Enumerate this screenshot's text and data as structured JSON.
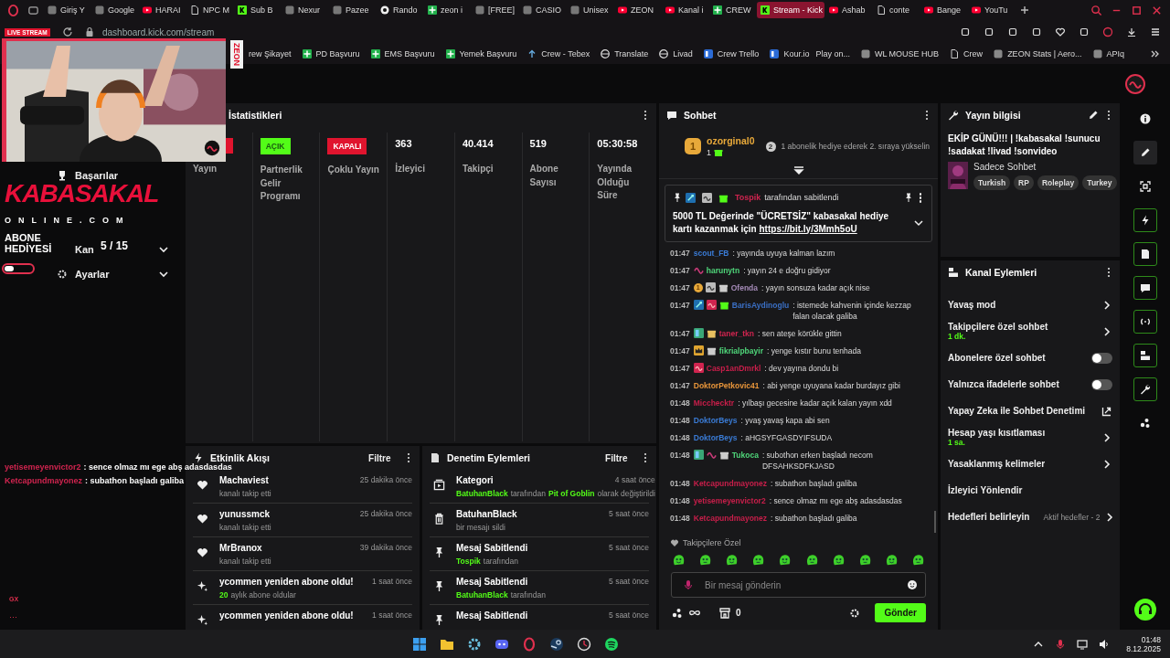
{
  "browser": {
    "tabs": [
      {
        "title": "Giriş Y",
        "kind": "generic",
        "selected": false
      },
      {
        "title": "Google",
        "kind": "generic",
        "selected": false
      },
      {
        "title": "HARAI",
        "kind": "youtube",
        "selected": false
      },
      {
        "title": "NPC M",
        "kind": "doc",
        "selected": false
      },
      {
        "title": "Sub B",
        "kind": "kick",
        "selected": false
      },
      {
        "title": "Nexur",
        "kind": "generic",
        "selected": false
      },
      {
        "title": "Pazee",
        "kind": "generic",
        "selected": false
      },
      {
        "title": "Rando",
        "kind": "github",
        "selected": false
      },
      {
        "title": "zeon i",
        "kind": "sheet",
        "selected": false
      },
      {
        "title": "[FREE]",
        "kind": "generic",
        "selected": false
      },
      {
        "title": "CASIO",
        "kind": "generic",
        "selected": false
      },
      {
        "title": "Unisex",
        "kind": "generic",
        "selected": false
      },
      {
        "title": "ZEON",
        "kind": "youtube",
        "selected": false
      },
      {
        "title": "Kanal i",
        "kind": "youtube",
        "selected": false
      },
      {
        "title": "CREW",
        "kind": "sheet",
        "selected": false
      },
      {
        "title": "Stream - Kick",
        "kind": "kick",
        "selected": true
      },
      {
        "title": "Ashab",
        "kind": "youtube",
        "selected": false
      },
      {
        "title": "conte",
        "kind": "doc",
        "selected": false
      },
      {
        "title": "Bange",
        "kind": "youtube",
        "selected": false
      },
      {
        "title": "YouTu",
        "kind": "youtube",
        "selected": false
      }
    ],
    "url": "dashboard.kick.com/stream",
    "bookmarks": [
      {
        "label": "rew Şikayet"
      },
      {
        "label": "PD Başvuru",
        "kind": "sheet"
      },
      {
        "label": "EMS Başvuru",
        "kind": "sheet"
      },
      {
        "label": "Yemek Başvuru",
        "kind": "sheet"
      },
      {
        "label": "Crew - Tebex",
        "kind": "arrow"
      },
      {
        "label": "Translate",
        "kind": "globe"
      },
      {
        "label": "Livad",
        "kind": "globe"
      },
      {
        "label": "Crew Trello",
        "kind": "board"
      },
      {
        "label": "Kour.io",
        "after": "Play on...",
        "kind": "board"
      },
      {
        "label": "WL MOUSE HUB",
        "kind": "generic"
      },
      {
        "label": "Crew",
        "kind": "doc"
      },
      {
        "label": "ZEON Stats | Aero...",
        "kind": "generic"
      },
      {
        "label": "APIq",
        "kind": "generic"
      }
    ]
  },
  "overlay": {
    "live_badge": "LIVE STREAM",
    "side_text": "ZEON",
    "logo": "KABASAKAL",
    "logo_sub": "ONLINE.COM",
    "goal_label": "ABONE HEDİYESİ",
    "goal_count": "5 / 15",
    "level": 0.33,
    "chat": [
      {
        "user": "yetisemeyenvictor2",
        "text": ": sence olmaz mı ege abş adasdasdas"
      },
      {
        "user": "Ketcapundmayonez",
        "text": ": subathon başladı galiba"
      }
    ],
    "corner_label": "GX",
    "corner_more": "···"
  },
  "sidebar": {
    "items": [
      {
        "label": "Başarılar",
        "kind": "trophy",
        "expandable": false
      },
      {
        "label": "Kan",
        "expandable": true
      },
      {
        "label": "Ayarlar",
        "kind": "gear",
        "expandable": true
      }
    ]
  },
  "stats": {
    "title": "İstatistikleri",
    "cells": [
      {
        "kind": "status",
        "on": false,
        "label": "Yayın"
      },
      {
        "kind": "status",
        "on": true,
        "badge": "AÇIK",
        "label": "Partnerlik Gelir Programı"
      },
      {
        "kind": "status",
        "on": false,
        "badge": "KAPALI",
        "label": "Çoklu Yayın"
      },
      {
        "kind": "value",
        "value": "363",
        "label": "İzleyici"
      },
      {
        "kind": "value",
        "value": "40.414",
        "label": "Takipçi"
      },
      {
        "kind": "value",
        "value": "519",
        "label": "Abone Sayısı"
      },
      {
        "kind": "value",
        "value": "05:30:58",
        "label": "Yayında Olduğu Süre"
      }
    ]
  },
  "activity": {
    "title": "Etkinlik Akışı",
    "filter": "Filtre",
    "items": [
      {
        "kind": "heart",
        "name": "Machaviest",
        "time": "25 dakika önce",
        "sub": [
          {
            "text": "kanalı takip etti",
            "highlight": false
          }
        ]
      },
      {
        "kind": "heart",
        "name": "yunussmck",
        "time": "25 dakika önce",
        "sub": [
          {
            "text": "kanalı takip etti",
            "highlight": false
          }
        ]
      },
      {
        "kind": "heart",
        "name": "MrBranox",
        "time": "39 dakika önce",
        "sub": [
          {
            "text": "kanalı takip etti",
            "highlight": false
          }
        ]
      },
      {
        "kind": "sparkle",
        "name": "ycommen yeniden abone oldu!",
        "time": "1 saat önce",
        "sub": [
          {
            "text": "20",
            "highlight": true
          },
          {
            "text": "aylık abone oldular",
            "highlight": false
          }
        ]
      },
      {
        "kind": "sparkle",
        "name": "ycommen yeniden abone oldu!",
        "time": "1 saat önce"
      }
    ]
  },
  "moderation": {
    "title": "Denetim Eylemleri",
    "filter": "Filtre",
    "items": [
      {
        "kind": "category",
        "name": "Kategori",
        "time": "4 saat önce",
        "sub": [
          {
            "text": "BatuhanBlack",
            "highlight": true
          },
          {
            "text": "tarafından",
            "highlight": false
          },
          {
            "text": "Pit of Goblin",
            "highlight": true
          },
          {
            "text": "olarak değiştirildi",
            "highlight": false
          }
        ]
      },
      {
        "kind": "trash",
        "name": "BatuhanBlack",
        "time": "5 saat önce",
        "sub": [
          {
            "text": "bir mesajı sildi",
            "highlight": false
          }
        ]
      },
      {
        "kind": "pin",
        "name": "Mesaj Sabitlendi",
        "time": "5 saat önce",
        "sub": [
          {
            "text": "Tospik",
            "highlight": true
          },
          {
            "text": "tarafından",
            "highlight": false
          }
        ]
      },
      {
        "kind": "pin",
        "name": "Mesaj Sabitlendi",
        "time": "5 saat önce",
        "sub": [
          {
            "text": "BatuhanBlack",
            "highlight": true
          },
          {
            "text": "tarafından",
            "highlight": false
          }
        ]
      },
      {
        "kind": "pin",
        "name": "Mesaj Sabitlendi",
        "time": "5 saat önce"
      }
    ]
  },
  "chat": {
    "title": "Sohbet",
    "leader": {
      "rank": "1",
      "user": "ozorginal0",
      "count": "1",
      "next_rank": "2",
      "hint": "1 abonelik hediye ederek 2. sıraya yükselin"
    },
    "pinned": {
      "badges": [
        {
          "kind": "mod"
        },
        {
          "kind": "og"
        },
        {
          "kind": "gift"
        }
      ],
      "by": "Tospik",
      "by_suffix": "tarafından sabitlendi",
      "text": "5000 TL Değerinde \"ÜCRETSİZ\" kabasakal hediye kartı kazanmak için",
      "link": "https://bit.ly/3Mmh5oU"
    },
    "messages": [
      {
        "time": "01:47",
        "user": "scout_FB",
        "color": "#3a7bd5",
        "text": ": yayında uyuya kalman lazım"
      },
      {
        "time": "01:47",
        "badges": [
          {
            "kind": "wave"
          }
        ],
        "user": "harunytn",
        "color": "#4fd67a",
        "text": ": yayın 24 e doğru gidiyor"
      },
      {
        "time": "01:47",
        "badges": [
          {
            "kind": "rank",
            "text": "1"
          },
          {
            "kind": "og"
          },
          {
            "kind": "giftgrey"
          }
        ],
        "user": "Ofenda",
        "color": "#a58bb8",
        "text": ": yayın sonsuza kadar açık nise"
      },
      {
        "time": "01:47",
        "badges": [
          {
            "kind": "mod"
          },
          {
            "kind": "sub"
          },
          {
            "kind": "gift"
          }
        ],
        "user": "BarisAydinoglu",
        "color": "#3a6fc4",
        "text": ": istemede kahvenin içinde kezzap falan olacak galiba"
      },
      {
        "time": "01:47",
        "badges": [
          {
            "kind": "vip"
          },
          {
            "kind": "giftgold"
          }
        ],
        "user": "taner_tkn",
        "color": "#d0244f",
        "text": ": sen ateşe körükle gittin"
      },
      {
        "time": "01:47",
        "badges": [
          {
            "kind": "crown"
          },
          {
            "kind": "giftgrey"
          }
        ],
        "user": "fikrialpbayir",
        "color": "#4fd67a",
        "text": ": yenge kıstır bunu tenhada"
      },
      {
        "time": "01:47",
        "badges": [
          {
            "kind": "sub"
          }
        ],
        "user": "Casp1anDmrkl",
        "color": "#c81e4a",
        "text": ": dev yayına dondu bi"
      },
      {
        "time": "01:47",
        "user": "DoktorPetkovic41",
        "color": "#e8953a",
        "text": ": abi yenge uyuyana kadar burdayız gibi"
      },
      {
        "time": "01:48",
        "user": "Micchecktr",
        "color": "#c81e4a",
        "text": ": yılbaşı gecesine kadar açık kalan yayın xdd"
      },
      {
        "time": "01:48",
        "user": "DoktorBeys",
        "color": "#3a7bd5",
        "text": ": yvaş yavaş kapa abi sen"
      },
      {
        "time": "01:48",
        "user": "DoktorBeys",
        "color": "#3a7bd5",
        "text": ": aHGSYFGASDYIFSUDA"
      },
      {
        "time": "01:48",
        "badges": [
          {
            "kind": "vip"
          },
          {
            "kind": "wave"
          },
          {
            "kind": "giftgrey"
          }
        ],
        "user": "Tukoca",
        "color": "#4fd67a",
        "text": ": subothon erken başladı necom DFSAHKSDFKJASD"
      },
      {
        "time": "01:48",
        "user": "Ketcapundmayonez",
        "color": "#c81e4a",
        "text": ": subathon başladı galiba"
      },
      {
        "time": "01:48",
        "user": "yetisemeyenvictor2",
        "color": "#c81e4a",
        "text": ": sence olmaz mı ege abş adasdasdas"
      },
      {
        "time": "01:48",
        "user": "Ketcapundmayonez",
        "color": "#c81e4a",
        "text": ": subathon başladı galiba"
      }
    ],
    "emote_label": "Takipçilere Özel",
    "input": {
      "placeholder": "Bir mesaj gönderin"
    },
    "points": "0",
    "send": "Gönder"
  },
  "stream_info": {
    "title": "Yayın bilgisi",
    "stream_title": "EKİP GÜNÜ!!! | !kabasakal !sunucu !sadakat !livad !sonvideo",
    "category": "Sadece Sohbet",
    "tags": [
      "Turkish",
      "RP",
      "Roleplay",
      "Turkey"
    ]
  },
  "channel_actions": {
    "title": "Kanal Eylemleri",
    "items": [
      {
        "kind": "link",
        "label": "Yavaş mod"
      },
      {
        "kind": "link",
        "label": "Takipçilere özel sohbet",
        "sub": "1 dk."
      },
      {
        "kind": "toggle",
        "label": "Abonelere özel sohbet",
        "on": false
      },
      {
        "kind": "toggle",
        "label": "Yalnızca ifadelerle sohbet",
        "on": false
      },
      {
        "kind": "external",
        "label": "Yapay Zeka ile Sohbet Denetimi"
      },
      {
        "kind": "link",
        "label": "Hesap yaşı kısıtlaması",
        "sub": "1 sa."
      },
      {
        "kind": "link",
        "label": "Yasaklanmış kelimeler"
      },
      {
        "kind": "plain",
        "label": "İzleyici Yönlendir"
      },
      {
        "kind": "link",
        "label": "Hedefleri belirleyin",
        "status": "Aktif hedefler - 2"
      }
    ]
  },
  "rail": [
    {
      "kind": "info",
      "active": false,
      "selected": false
    },
    {
      "kind": "pencil",
      "active": false,
      "selected": true
    },
    {
      "kind": "focus",
      "active": false,
      "selected": false
    },
    {
      "kind": "bolt",
      "active": true,
      "selected": false
    },
    {
      "kind": "doc",
      "active": true,
      "selected": false
    },
    {
      "kind": "chat",
      "active": true,
      "selected": false
    },
    {
      "kind": "broadcast",
      "active": true,
      "selected": false
    },
    {
      "kind": "panel",
      "active": true,
      "selected": false
    },
    {
      "kind": "wrench",
      "active": true,
      "selected": false
    },
    {
      "kind": "dots",
      "active": false,
      "selected": false
    }
  ],
  "taskbar": {
    "time": "01:48",
    "date": "8.12.2025"
  }
}
